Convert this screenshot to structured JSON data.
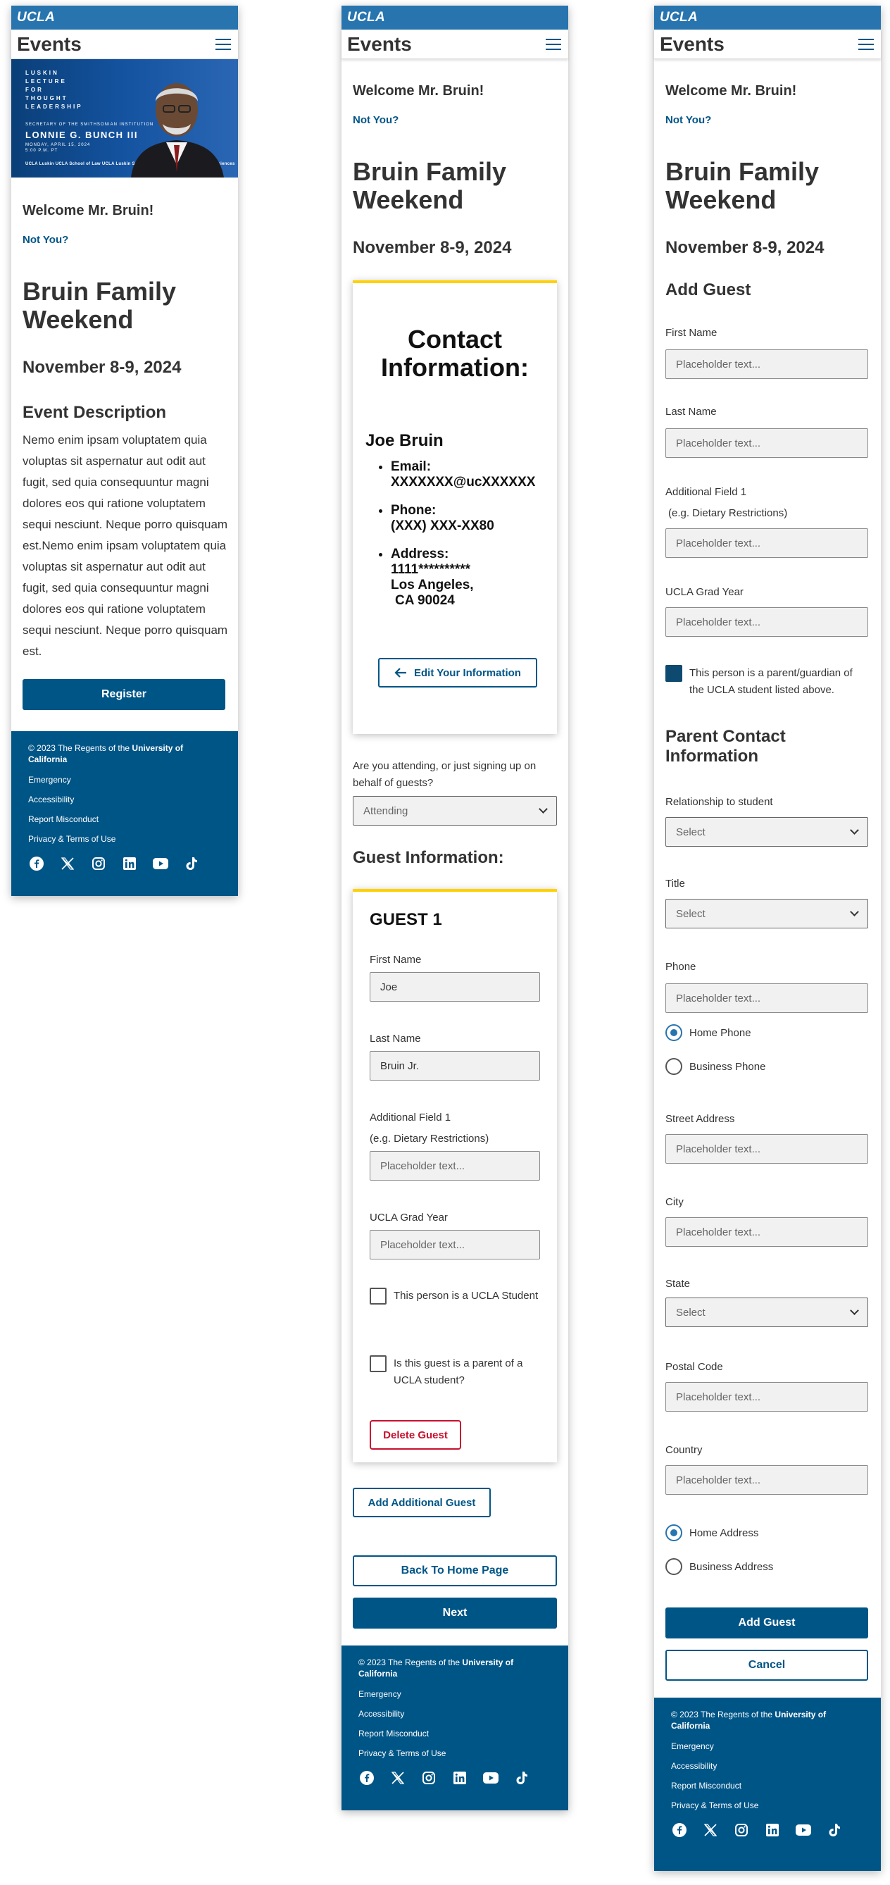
{
  "brand": {
    "logo": "UCLA",
    "app_title": "Events",
    "menu_icon": "hamburger-icon"
  },
  "colors": {
    "ucla_blue": "#2774ae",
    "dark_blue": "#005587",
    "gold": "#ffd100",
    "delete_red": "#c8102e"
  },
  "hero": {
    "line1": "LUSKIN",
    "line2": "LECTURE",
    "line3": "FOR",
    "line4": "THOUGHT",
    "line5": "LEADERSHIP",
    "secretary": "SECRETARY OF THE SMITHSONIAN INSTITUTION",
    "speaker": "LONNIE G. BUNCH III",
    "date": "MONDAY, APRIL 15, 2024",
    "time": "5:00 P.M. PT",
    "logos": "UCLA Luskin   UCLA School of Law   UCLA Luskin School of Public Affairs   UCLA Social Sciences"
  },
  "common": {
    "welcome": "Welcome Mr. Bruin!",
    "not_you": "Not You?",
    "event_title": "Bruin Family Weekend",
    "event_date": "November 8-9, 2024"
  },
  "screen1": {
    "description_heading": "Event Description",
    "description": "Nemo enim ipsam voluptatem quia voluptas sit aspernatur aut odit aut fugit, sed quia consequuntur magni dolores eos qui ratione voluptatem sequi nesciunt. Neque porro quisquam est.Nemo enim ipsam voluptatem quia voluptas sit aspernatur aut odit aut fugit, sed quia consequuntur magni dolores eos qui ratione voluptatem sequi nesciunt. Neque porro quisquam est.",
    "register": "Register"
  },
  "screen2": {
    "contact_heading": "Contact Information:",
    "contact_name": "Joe Bruin",
    "email_label": "Email:",
    "email_value": "XXXXXXX@ucXXXXXX",
    "phone_label": "Phone:",
    "phone_value": "(XXX) XXX-XX80",
    "address_label": "Address:",
    "address_line1": "1111**********",
    "address_line2": "Los Angeles,",
    "address_line3": "CA   90024",
    "edit_button": "Edit Your Information",
    "attending_question": "Are you attending, or just signing up on behalf of guests?",
    "attending_value": "Attending",
    "guest_info_heading": "Guest Information:",
    "guest_heading": "GUEST 1",
    "first_name_label": "First Name",
    "first_name_value": "Joe",
    "last_name_label": "Last Name",
    "last_name_value": "Bruin Jr.",
    "additional_label": "Additional Field 1",
    "additional_hint": "(e.g. Dietary Restrictions)",
    "additional_placeholder": "Placeholder text...",
    "grad_year_label": "UCLA Grad Year",
    "grad_year_placeholder": "Placeholder text...",
    "cb_student": "This person is a UCLA Student",
    "cb_parent": "Is this guest is a parent of a UCLA student?",
    "delete_guest": "Delete Guest",
    "add_guest": "Add Additional Guest",
    "back_home": "Back To Home Page",
    "next": "Next"
  },
  "screen3": {
    "add_guest_heading": "Add Guest",
    "first_name_label": "First Name",
    "last_name_label": "Last Name",
    "additional_label": "Additional Field 1",
    "additional_hint": "(e.g. Dietary Restrictions)",
    "grad_year_label": "UCLA Grad Year",
    "placeholder": "Placeholder text...",
    "parent_checkbox": "This person is a parent/guardian of the UCLA student listed above.",
    "parent_contact_heading": "Parent Contact Information",
    "relationship_label": "Relationship to student",
    "title_label": "Title",
    "phone_label": "Phone",
    "home_phone": "Home Phone",
    "business_phone": "Business Phone",
    "street_label": "Street Address",
    "city_label": "City",
    "state_label": "State",
    "postal_label": "Postal Code",
    "country_label": "Country",
    "home_address": "Home Address",
    "business_address": "Business Address",
    "select": "Select",
    "add_guest_button": "Add Guest",
    "cancel": "Cancel"
  },
  "footer": {
    "copyright_prefix": "© 2023 The Regents of the",
    "copyright_bold": "University of California",
    "links": [
      "Emergency",
      "Accessibility",
      "Report Misconduct",
      "Privacy & Terms of Use"
    ],
    "social_icons": [
      "facebook-icon",
      "x-icon",
      "instagram-icon",
      "linkedin-icon",
      "youtube-icon",
      "tiktok-icon"
    ]
  }
}
